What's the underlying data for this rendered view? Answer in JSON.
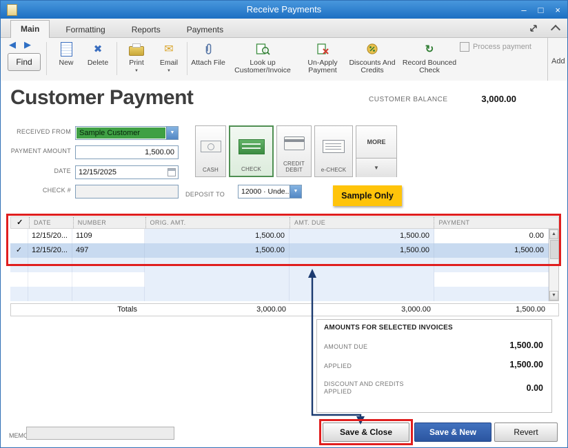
{
  "titlebar": {
    "title": "Receive Payments",
    "minimize_glyph": "–",
    "maximize_glyph": "□",
    "close_glyph": "×"
  },
  "tabs": {
    "main": "Main",
    "formatting": "Formatting",
    "reports": "Reports",
    "payments": "Payments"
  },
  "glyphs": {
    "back": "◀",
    "forward": "▶",
    "dropdown": "▼",
    "up_arrow": "▲",
    "down_arrow": "▼",
    "delete_x": "✖",
    "envelope": "✉",
    "refresh": "↻",
    "check": "✓"
  },
  "toolbar": {
    "find": "Find",
    "new": "New",
    "delete": "Delete",
    "print": "Print",
    "email": "Email",
    "attach": "Attach File",
    "lookup": "Look up Customer/Invoice",
    "unapply": "Un-Apply Payment",
    "discounts": "Discounts And Credits",
    "bounced": "Record Bounced Check",
    "process_payment": "Process payment",
    "add": "Add"
  },
  "header": {
    "title": "Customer Payment",
    "balance_label": "CUSTOMER BALANCE",
    "balance_value": "3,000.00"
  },
  "form": {
    "received_from": {
      "label": "RECEIVED FROM",
      "value": "Sample Customer"
    },
    "payment_amount": {
      "label": "PAYMENT AMOUNT",
      "value": "1,500.00"
    },
    "date": {
      "label": "DATE",
      "value": "12/15/2025"
    },
    "check_no": {
      "label": "CHECK #",
      "value": ""
    },
    "deposit_to": {
      "label": "DEPOSIT TO",
      "value": "12000 · Unde..."
    },
    "sample_badge": "Sample Only"
  },
  "payment_methods": {
    "cash": "CASH",
    "check": "CHECK",
    "credit": "CREDIT DEBIT",
    "echeck": "e-CHECK",
    "more": "MORE"
  },
  "table": {
    "headers": {
      "check": "✓",
      "date": "DATE",
      "number": "NUMBER",
      "orig": "ORIG. AMT.",
      "due": "AMT. DUE",
      "payment": "PAYMENT"
    },
    "rows": [
      {
        "check": "",
        "date": "12/15/20...",
        "number": "1109",
        "orig": "1,500.00",
        "due": "1,500.00",
        "payment": "0.00"
      },
      {
        "check": "✓",
        "date": "12/15/20...",
        "number": "497",
        "orig": "1,500.00",
        "due": "1,500.00",
        "payment": "1,500.00"
      }
    ],
    "totals_label": "Totals",
    "totals": {
      "orig": "3,000.00",
      "due": "3,000.00",
      "payment": "1,500.00"
    }
  },
  "summary": {
    "title": "AMOUNTS FOR SELECTED INVOICES",
    "amount_due_label": "AMOUNT DUE",
    "amount_due_value": "1,500.00",
    "applied_label": "APPLIED",
    "applied_value": "1,500.00",
    "discount_label": "DISCOUNT AND CREDITS APPLIED",
    "discount_value": "0.00"
  },
  "footer": {
    "memo_label": "MEMO",
    "memo_value": "",
    "save_close": "Save & Close",
    "save_new": "Save & New",
    "revert": "Revert"
  }
}
